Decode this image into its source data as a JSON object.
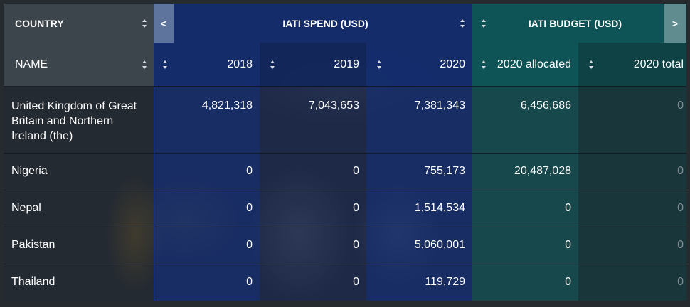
{
  "header": {
    "group_country": "COUNTRY",
    "prev_label": "<",
    "group_spend": "IATI SPEND (USD)",
    "group_budget": "IATI BUDGET (USD)",
    "next_label": ">",
    "columns": {
      "name": "NAME",
      "spend_2018": "2018",
      "spend_2019": "2019",
      "spend_2020": "2020",
      "budget_2020_allocated": "2020 allocated",
      "budget_2020_total": "2020 total"
    }
  },
  "rows": [
    {
      "name": "United Kingdom of Great Britain and Northern Ireland (the)",
      "s2018": "4,821,318",
      "s2019": "7,043,653",
      "s2020": "7,381,343",
      "alloc": "6,456,686",
      "total": "0"
    },
    {
      "name": "Nigeria",
      "s2018": "0",
      "s2019": "0",
      "s2020": "755,173",
      "alloc": "20,487,028",
      "total": "0"
    },
    {
      "name": "Nepal",
      "s2018": "0",
      "s2019": "0",
      "s2020": "1,514,534",
      "alloc": "0",
      "total": "0"
    },
    {
      "name": "Pakistan",
      "s2018": "0",
      "s2019": "0",
      "s2020": "5,060,001",
      "alloc": "0",
      "total": "0"
    },
    {
      "name": "Thailand",
      "s2018": "0",
      "s2019": "0",
      "s2020": "119,729",
      "alloc": "0",
      "total": "0"
    }
  ]
}
